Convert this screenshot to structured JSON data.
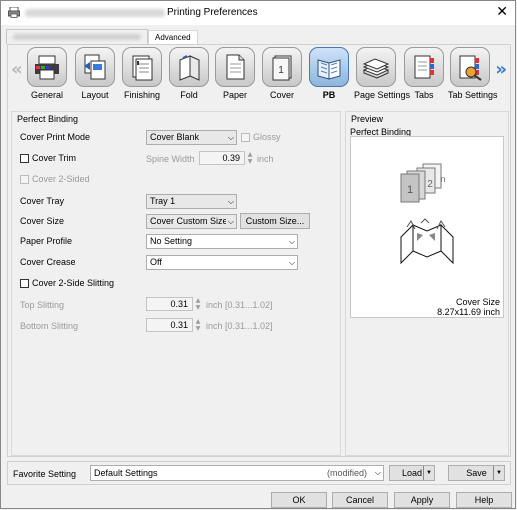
{
  "window": {
    "title": "Printing Preferences",
    "close_glyph": "✕"
  },
  "tabs": [
    {
      "label": ""
    },
    {
      "label": "Advanced"
    }
  ],
  "nav": {
    "left_arrow": "«",
    "right_arrow": "»"
  },
  "toolbar": {
    "items": [
      {
        "label": "General",
        "icon": "printer-icon"
      },
      {
        "label": "Layout",
        "icon": "layout-icon"
      },
      {
        "label": "Finishing",
        "icon": "finishing-icon"
      },
      {
        "label": "Fold",
        "icon": "fold-icon"
      },
      {
        "label": "Paper",
        "icon": "paper-icon"
      },
      {
        "label": "Cover",
        "icon": "cover-icon"
      },
      {
        "label": "PB",
        "icon": "perfect-binding-icon",
        "selected": true
      },
      {
        "label": "Page Settings",
        "icon": "page-settings-icon"
      },
      {
        "label": "Tabs",
        "icon": "tabs-icon"
      },
      {
        "label": "Tab Settings",
        "icon": "tab-settings-icon"
      }
    ],
    "cover_icon_text": "1"
  },
  "settings": {
    "group_title": "Perfect Binding",
    "cover_print_mode": {
      "label": "Cover Print Mode",
      "value": "Cover Blank"
    },
    "glossy": {
      "label": "Glossy",
      "checked": false,
      "enabled": false
    },
    "cover_trim": {
      "label": "Cover Trim",
      "checked": false
    },
    "spine_width": {
      "label": "Spine Width",
      "value": "0.39",
      "unit": "inch",
      "enabled": false
    },
    "cover_2sided": {
      "label": "Cover 2-Sided",
      "checked": false,
      "enabled": false
    },
    "cover_tray": {
      "label": "Cover Tray",
      "value": "Tray 1"
    },
    "cover_size": {
      "label": "Cover Size",
      "value": "Cover Custom Size",
      "button": "Custom Size..."
    },
    "paper_profile": {
      "label": "Paper Profile",
      "value": "No Setting"
    },
    "cover_crease": {
      "label": "Cover Crease",
      "value": "Off"
    },
    "cover_2side_slitting": {
      "label": "Cover 2-Side Slitting",
      "checked": false
    },
    "top_slitting": {
      "label": "Top Slitting",
      "value": "0.31",
      "unit": "inch [0.31...1.02]",
      "enabled": false
    },
    "bottom_slitting": {
      "label": "Bottom Slitting",
      "value": "0.31",
      "unit": "inch [0.31...1.02]",
      "enabled": false
    }
  },
  "preview": {
    "group_title": "Preview",
    "subtitle": "Perfect Binding",
    "page1": "1",
    "page2": "2",
    "pagen": "n",
    "size_label": "Cover Size",
    "size_value": "8.27x11.69 inch"
  },
  "favorite": {
    "label": "Favorite Setting",
    "value": "Default Settings",
    "status": "(modified)",
    "load": "Load",
    "save": "Save"
  },
  "buttons": {
    "ok": "OK",
    "cancel": "Cancel",
    "apply": "Apply",
    "help": "Help"
  },
  "glyphs": {
    "dropdown": "⌵",
    "up": "▲",
    "down": "▼",
    "menu": "▼"
  }
}
